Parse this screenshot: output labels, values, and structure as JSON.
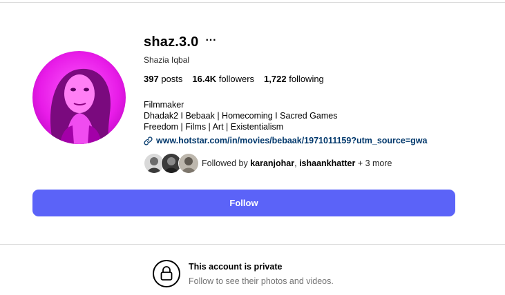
{
  "profile": {
    "username": "shaz.3.0",
    "more_options_icon": "ellipsis-icon",
    "full_name": "Shazia Iqbal",
    "stats": {
      "posts_count": "397",
      "posts_label": "posts",
      "followers_count": "16.4K",
      "followers_label": "followers",
      "following_count": "1,722",
      "following_label": "following"
    },
    "bio": {
      "line1": "Filmmaker",
      "line2": "Dhadak2 I Bebaak | Homecoming I Sacred Games",
      "line3": "Freedom | Films | Art | Existentialism"
    },
    "link": {
      "icon": "link-icon",
      "url_text": "www.hotstar.com/in/movies/bebaak/1971011159?utm_source=gwa"
    },
    "followed_by": {
      "prefix": "Followed by ",
      "account1": "karanjohar",
      "separator": ", ",
      "account2": "ishaankhatter",
      "suffix": " + 3 more"
    }
  },
  "actions": {
    "follow_label": "Follow"
  },
  "private_notice": {
    "icon": "lock-icon",
    "title": "This account is private",
    "subtitle": "Follow to see their photos and videos."
  },
  "colors": {
    "follow_button_bg": "#5b63f8",
    "link_color": "#00376b",
    "secondary_text": "#737373",
    "divider": "#dbdbdb",
    "avatar_tint": "#e81ce8"
  }
}
